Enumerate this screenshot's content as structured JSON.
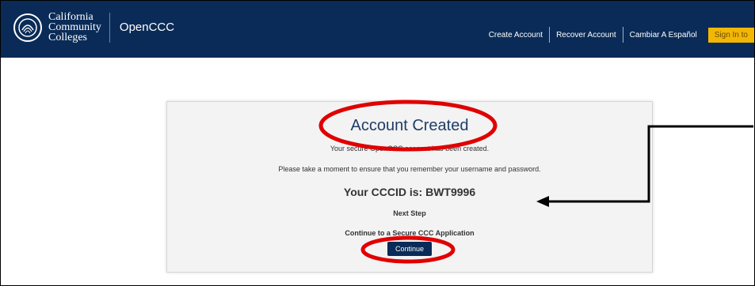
{
  "header": {
    "logo_lines": [
      "California",
      "Community",
      "Colleges"
    ],
    "brand": "OpenCCC",
    "nav": {
      "create_account": "Create Account",
      "recover_account": "Recover Account",
      "spanish": "Cambiar A Español",
      "sign_in": "Sign In to"
    },
    "colors": {
      "background": "#0a2b57",
      "sign_in": "#f2b705"
    }
  },
  "card": {
    "title": "Account Created",
    "line1": "Your secure OpenCCC account has been created.",
    "line2": "Please take a moment to ensure that you remember your username and password.",
    "cccid": "Your CCCID is: BWT9996",
    "next_step": "Next Step",
    "continue_text": "Continue to a Secure CCC Application",
    "continue_button": "Continue"
  },
  "annotations": {
    "color": "#e00000",
    "arrow_color": "#000000"
  }
}
